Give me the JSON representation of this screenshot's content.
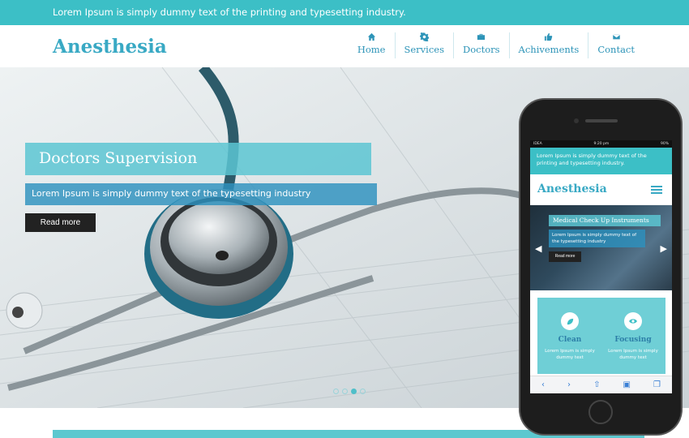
{
  "topbar": {
    "text": "Lorem Ipsum is simply dummy text of the printing and typesetting industry."
  },
  "header": {
    "logo": "Anesthesia",
    "nav": [
      {
        "label": "Home",
        "icon": "home-icon"
      },
      {
        "label": "Services",
        "icon": "gear-icon"
      },
      {
        "label": "Doctors",
        "icon": "briefcase-icon"
      },
      {
        "label": "Achivements",
        "icon": "thumbs-up-icon"
      },
      {
        "label": "Contact",
        "icon": "envelope-icon"
      }
    ]
  },
  "hero": {
    "title": "Doctors Supervision",
    "subtitle": "Lorem Ipsum is simply dummy text of the typesetting industry",
    "button": "Read more",
    "slide_count": 4,
    "active_slide": 3
  },
  "phone": {
    "status": {
      "carrier": "IDEA",
      "time": "9:20 pm",
      "battery": "90%"
    },
    "topbar": "Lorem Ipsum is simply dummy text of the printing and typesetting industry.",
    "logo": "Anesthesia",
    "slider": {
      "title": "Medical Check Up Instruments",
      "subtitle": "Lorem Ipsum is simply dummy text of the typesetting industry",
      "button": "Read more"
    },
    "features": [
      {
        "title": "Clean",
        "text": "Lorem Ipsum is simply dummy text",
        "icon": "leaf-icon"
      },
      {
        "title": "Focusing",
        "text": "Lorem Ipsum is simply dummy text",
        "icon": "eye-icon"
      }
    ]
  },
  "colors": {
    "accent": "#3cbfc6",
    "brand": "#39a9c4",
    "dark_button": "#222222"
  }
}
